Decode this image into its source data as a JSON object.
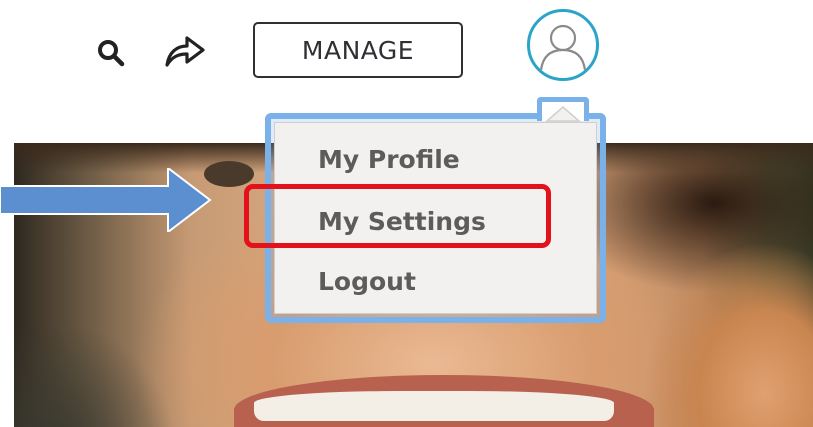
{
  "header": {
    "manage_label": "MANAGE",
    "icons": {
      "search": "search-icon",
      "share": "share-icon",
      "avatar": "user-avatar-icon"
    }
  },
  "user_menu": {
    "items": [
      {
        "label": "My Profile"
      },
      {
        "label": "My Settings",
        "highlighted": true
      },
      {
        "label": "Logout"
      }
    ]
  },
  "colors": {
    "avatar_ring": "#2aa5c8",
    "menu_glow": "#7ab1e8",
    "highlight": "#e3121a",
    "pointer_arrow": "#5b8fd0",
    "menu_text": "#5c5c5c"
  }
}
